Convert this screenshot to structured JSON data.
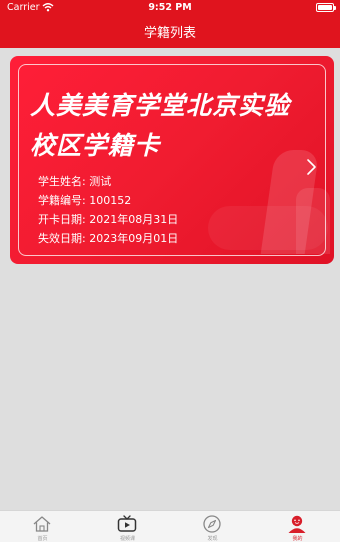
{
  "status_bar": {
    "carrier": "Carrier",
    "time": "9:52 PM"
  },
  "nav": {
    "title": "学籍列表"
  },
  "card": {
    "title": "人美美育学堂北京实验校区学籍卡",
    "rows": [
      {
        "label": "学生姓名:",
        "value": "测试"
      },
      {
        "label": "学籍编号:",
        "value": "100152"
      },
      {
        "label": "开卡日期:",
        "value": "2021年08月31日"
      },
      {
        "label": "失效日期:",
        "value": "2023年09月01日"
      }
    ]
  },
  "tabs": [
    {
      "label": "首页",
      "icon": "home-icon",
      "active": false
    },
    {
      "label": "视频课",
      "icon": "video-icon",
      "active": false
    },
    {
      "label": "发现",
      "icon": "compass-icon",
      "active": false
    },
    {
      "label": "我的",
      "icon": "profile-icon",
      "active": true
    }
  ],
  "colors": {
    "brand": "#e0141e",
    "card": "#f01c30",
    "active_tab": "#d81e2a",
    "inactive_tab": "#999999",
    "background": "#dedede"
  }
}
